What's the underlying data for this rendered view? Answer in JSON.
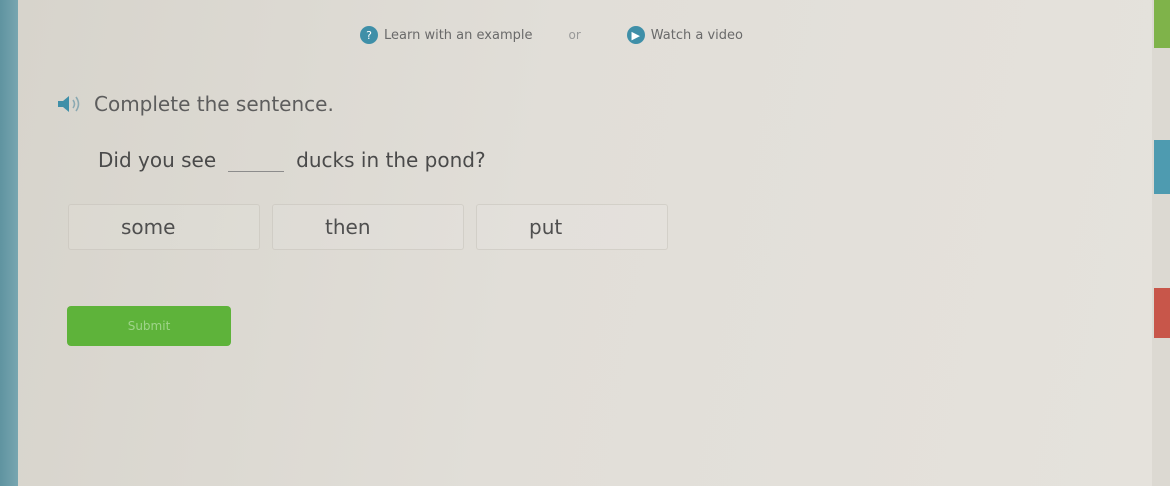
{
  "helper": {
    "learn_label": "Learn with an example",
    "learn_icon": "question-icon",
    "separator": "or",
    "video_label": "Watch a video",
    "video_icon": "play-icon"
  },
  "question": {
    "instruction": "Complete the sentence.",
    "sentence_before": "Did you see",
    "sentence_after": "ducks in the pond?"
  },
  "choices": [
    {
      "label": "some"
    },
    {
      "label": "then"
    },
    {
      "label": "put"
    }
  ],
  "submit_label": "Submit",
  "colors": {
    "accent_blue": "#3f8fa8",
    "submit_green": "#5eb33a",
    "strip_green": "#7fb34a",
    "strip_blue": "#4e9bb0",
    "strip_red": "#c8564a"
  }
}
